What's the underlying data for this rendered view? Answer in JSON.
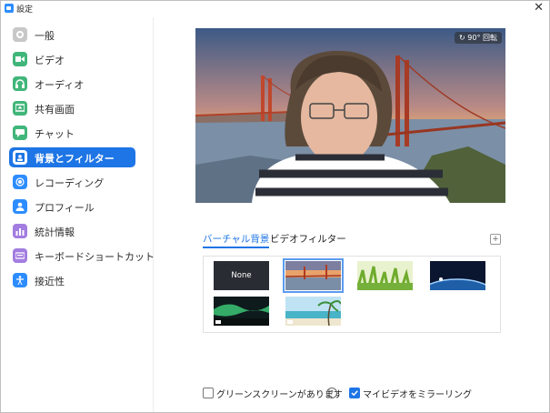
{
  "window": {
    "title": "設定"
  },
  "sidebar": {
    "items": [
      {
        "label": "一般",
        "icon": "gear-icon",
        "color": "#c8c8c8"
      },
      {
        "label": "ビデオ",
        "icon": "video-camera-icon",
        "color": "#41b67a"
      },
      {
        "label": "オーディオ",
        "icon": "headphones-icon",
        "color": "#41b67a"
      },
      {
        "label": "共有画面",
        "icon": "share-screen-icon",
        "color": "#41b67a"
      },
      {
        "label": "チャット",
        "icon": "chat-bubble-icon",
        "color": "#41b67a"
      },
      {
        "label": "背景とフィルター",
        "icon": "background-person-icon",
        "color": "#ffffff"
      },
      {
        "label": "レコーディング",
        "icon": "record-icon",
        "color": "#2d8cff"
      },
      {
        "label": "プロフィール",
        "icon": "profile-icon",
        "color": "#2d8cff"
      },
      {
        "label": "統計情報",
        "icon": "bar-chart-icon",
        "color": "#a37de0"
      },
      {
        "label": "キーボードショートカット",
        "icon": "keyboard-icon",
        "color": "#a37de0"
      },
      {
        "label": "接近性",
        "icon": "accessibility-icon",
        "color": "#2d8cff"
      }
    ],
    "active_index": 5
  },
  "preview": {
    "rotate_label": "90° 回転"
  },
  "tabs": [
    {
      "label": "バーチャル背景",
      "active": true
    },
    {
      "label": "ビデオフィルター",
      "active": false
    }
  ],
  "gallery": {
    "items": [
      {
        "label": "None",
        "kind": "none"
      },
      {
        "label": "",
        "kind": "golden-gate",
        "selected": true
      },
      {
        "label": "",
        "kind": "grass"
      },
      {
        "label": "",
        "kind": "earth"
      },
      {
        "label": "",
        "kind": "aurora"
      },
      {
        "label": "",
        "kind": "beach"
      }
    ]
  },
  "options": {
    "green_screen_label": "グリーンスクリーンがあります",
    "green_screen_checked": false,
    "mirror_label": "マイビデオをミラーリング",
    "mirror_checked": true
  }
}
